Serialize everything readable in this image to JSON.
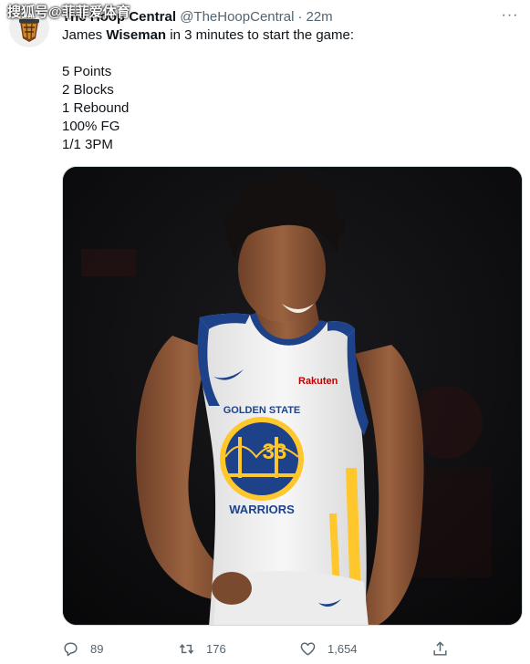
{
  "tweet": {
    "author_name": "The Hoop Central",
    "author_handle": "@TheHoopCentral",
    "separator": "·",
    "time": "22m",
    "more_label": "···",
    "watermark": "搜狐号@菲菲爱体育",
    "text_lines": [
      {
        "pre": "James ",
        "bold": "Wiseman",
        "post": " in 3 minutes to start the game:"
      },
      {
        "pre": "",
        "bold": "",
        "post": ""
      },
      {
        "pre": "5 Points",
        "bold": "",
        "post": ""
      },
      {
        "pre": "2 Blocks",
        "bold": "",
        "post": ""
      },
      {
        "pre": "1 Rebound",
        "bold": "",
        "post": ""
      },
      {
        "pre": "100% FG",
        "bold": "",
        "post": ""
      },
      {
        "pre": "1/1 3PM",
        "bold": "",
        "post": ""
      }
    ]
  },
  "photo": {
    "jersey_sponsor": "Rakuten",
    "jersey_logo_top": "GOLDEN STATE",
    "jersey_logo_bottom": "WARRIORS",
    "jersey_number": "33",
    "colors": {
      "jersey_blue": "#1d428a",
      "jersey_gold": "#ffc72c",
      "jersey_white": "#f4f4f4",
      "skin": "#8a5637"
    }
  },
  "actions": {
    "reply_count": "89",
    "retweet_count": "176",
    "like_count": "1,654",
    "reply_icon": "reply-icon",
    "retweet_icon": "retweet-icon",
    "like_icon": "heart-icon",
    "share_icon": "share-icon"
  }
}
